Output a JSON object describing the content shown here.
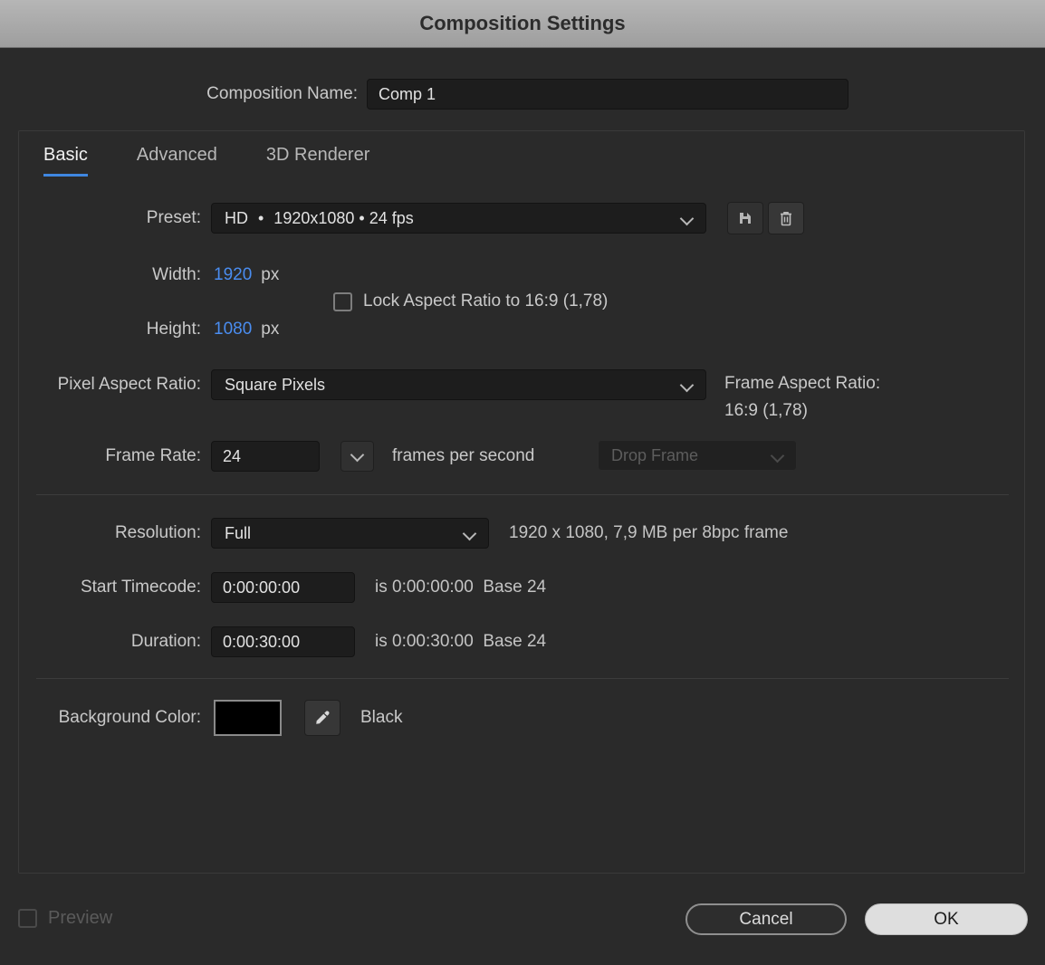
{
  "titlebar": {
    "title": "Composition Settings"
  },
  "composition_name": {
    "label": "Composition Name:",
    "value": "Comp 1"
  },
  "tabs": [
    {
      "label": "Basic",
      "active": true
    },
    {
      "label": "Advanced",
      "active": false
    },
    {
      "label": "3D Renderer",
      "active": false
    }
  ],
  "preset": {
    "label": "Preset:",
    "value": "HD  •  1920x1080 • 24 fps"
  },
  "dimensions": {
    "width_label": "Width:",
    "width_value": "1920",
    "width_unit": "px",
    "height_label": "Height:",
    "height_value": "1080",
    "height_unit": "px",
    "lock_label": "Lock Aspect Ratio to 16:9 (1,78)",
    "lock_checked": false
  },
  "pixel_aspect": {
    "label": "Pixel Aspect Ratio:",
    "value": "Square Pixels"
  },
  "frame_aspect": {
    "label": "Frame Aspect Ratio:",
    "value": "16:9 (1,78)"
  },
  "frame_rate": {
    "label": "Frame Rate:",
    "value": "24",
    "suffix": "frames per second",
    "drop_frame_label": "Drop Frame"
  },
  "resolution": {
    "label": "Resolution:",
    "value": "Full",
    "info": "1920 x 1080, 7,9 MB per 8bpc frame"
  },
  "start_timecode": {
    "label": "Start Timecode:",
    "value": "0:00:00:00",
    "info": "is 0:00:00:00  Base 24"
  },
  "duration": {
    "label": "Duration:",
    "value": "0:00:30:00",
    "info": "is 0:00:30:00  Base 24"
  },
  "background_color": {
    "label": "Background Color:",
    "swatch_color": "#000000",
    "color_name": "Black"
  },
  "footer": {
    "preview_label": "Preview",
    "cancel_label": "Cancel",
    "ok_label": "OK"
  },
  "colors": {
    "accent_blue": "#4a8df0",
    "dialog_bg": "#2a2a2a",
    "titlebar_bg": "#a9a9a9",
    "input_bg": "#1d1d1d",
    "panel_border": "#3a3a3a",
    "ok_button_bg": "#dedede"
  }
}
